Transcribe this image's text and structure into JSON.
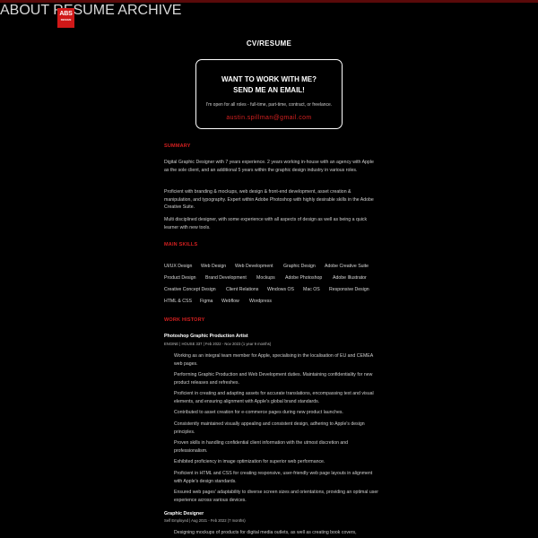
{
  "logo": {
    "text": "ABS",
    "sub": "DESIGN"
  },
  "nav": {
    "about": "ABOUT",
    "resume": "RESUME",
    "archive": "ARCHIVE"
  },
  "page_title": "CV/RESUME",
  "cta": {
    "line1": "WANT TO WORK WITH ME?",
    "line2": "SEND ME AN EMAIL!",
    "text": "I'm open for all roles - full-time, part-time, contract, or freelance.",
    "email": "austin.spillman@gmail.com"
  },
  "summary": {
    "heading": "SUMMARY",
    "p1": "Digital Graphic Designer with 7 years experience. 2 years working in-house with an agency with Apple as the sole client, and an additional 5 years within the graphic design industry in various roles.",
    "p2": "Proficient with branding & mockups, web design & front-end development, asset creation & manipulation, and typography. Expert within Adobe Photoshop with highly desirable skills in the Adobe Creative Suite.",
    "p3": "Multi disciplined designer, with some experience with all aspects of design as well as being a quick learner with new tools."
  },
  "skills": {
    "heading": "MAIN SKILLS",
    "items": [
      "UI/UX Design",
      "Web Design",
      "Web Development",
      "Graphic Design",
      "Adobe Creative Suite",
      "Product Design",
      "Brand Development",
      "Mockups",
      "Adobe Photoshop",
      "Adobe Illustrator",
      "Creative Concept Design",
      "Client Relations",
      "Windows OS",
      "Mac OS",
      "Responsive Design",
      "HTML & CSS",
      "Figma",
      "Webflow",
      "Wordpress"
    ]
  },
  "work": {
    "heading": "WORK HISTORY",
    "job1": {
      "title": "Photoshop Graphic Production Artist",
      "meta": "ENGINE | HOUSE 337 | Feb 2022 - Nov 2023 (1 year 9 months)",
      "bullets": [
        "Working as an integral team member for Apple, specialising in the localisation of EU and CEMEA web pages.",
        "Performing Graphic Production and Web Development duties. Maintaining confidentiality for new product releases and refreshes.",
        "Proficient in creating and adapting assets for accurate translations, encompassing text and visual elements, and ensuring alignment with Apple's global brand standards.",
        "Contributed to asset creation for e-commerce pages during new product launches.",
        "Consistently maintained visually appealing and consistent design, adhering to Apple's design principles.",
        "Proven skills in handling confidential client information with the utmost discretion and professionalism.",
        "Exhibited proficiency in image optimization for superior web performance.",
        "Proficient in HTML and CSS for creating responsive, user-friendly web page layouts in alignment with Apple's design standards.",
        "Ensured web pages' adaptability to diverse screen sizes and orientations, providing an optimal user experience across various devices."
      ]
    },
    "job2": {
      "title": "Graphic Designer",
      "meta": "Self Employed | Aug 2021 - Feb 2022 (7 months)",
      "bullets": [
        "Designing mockups of products for digital media outlets, as well as creating book covers,"
      ]
    }
  }
}
